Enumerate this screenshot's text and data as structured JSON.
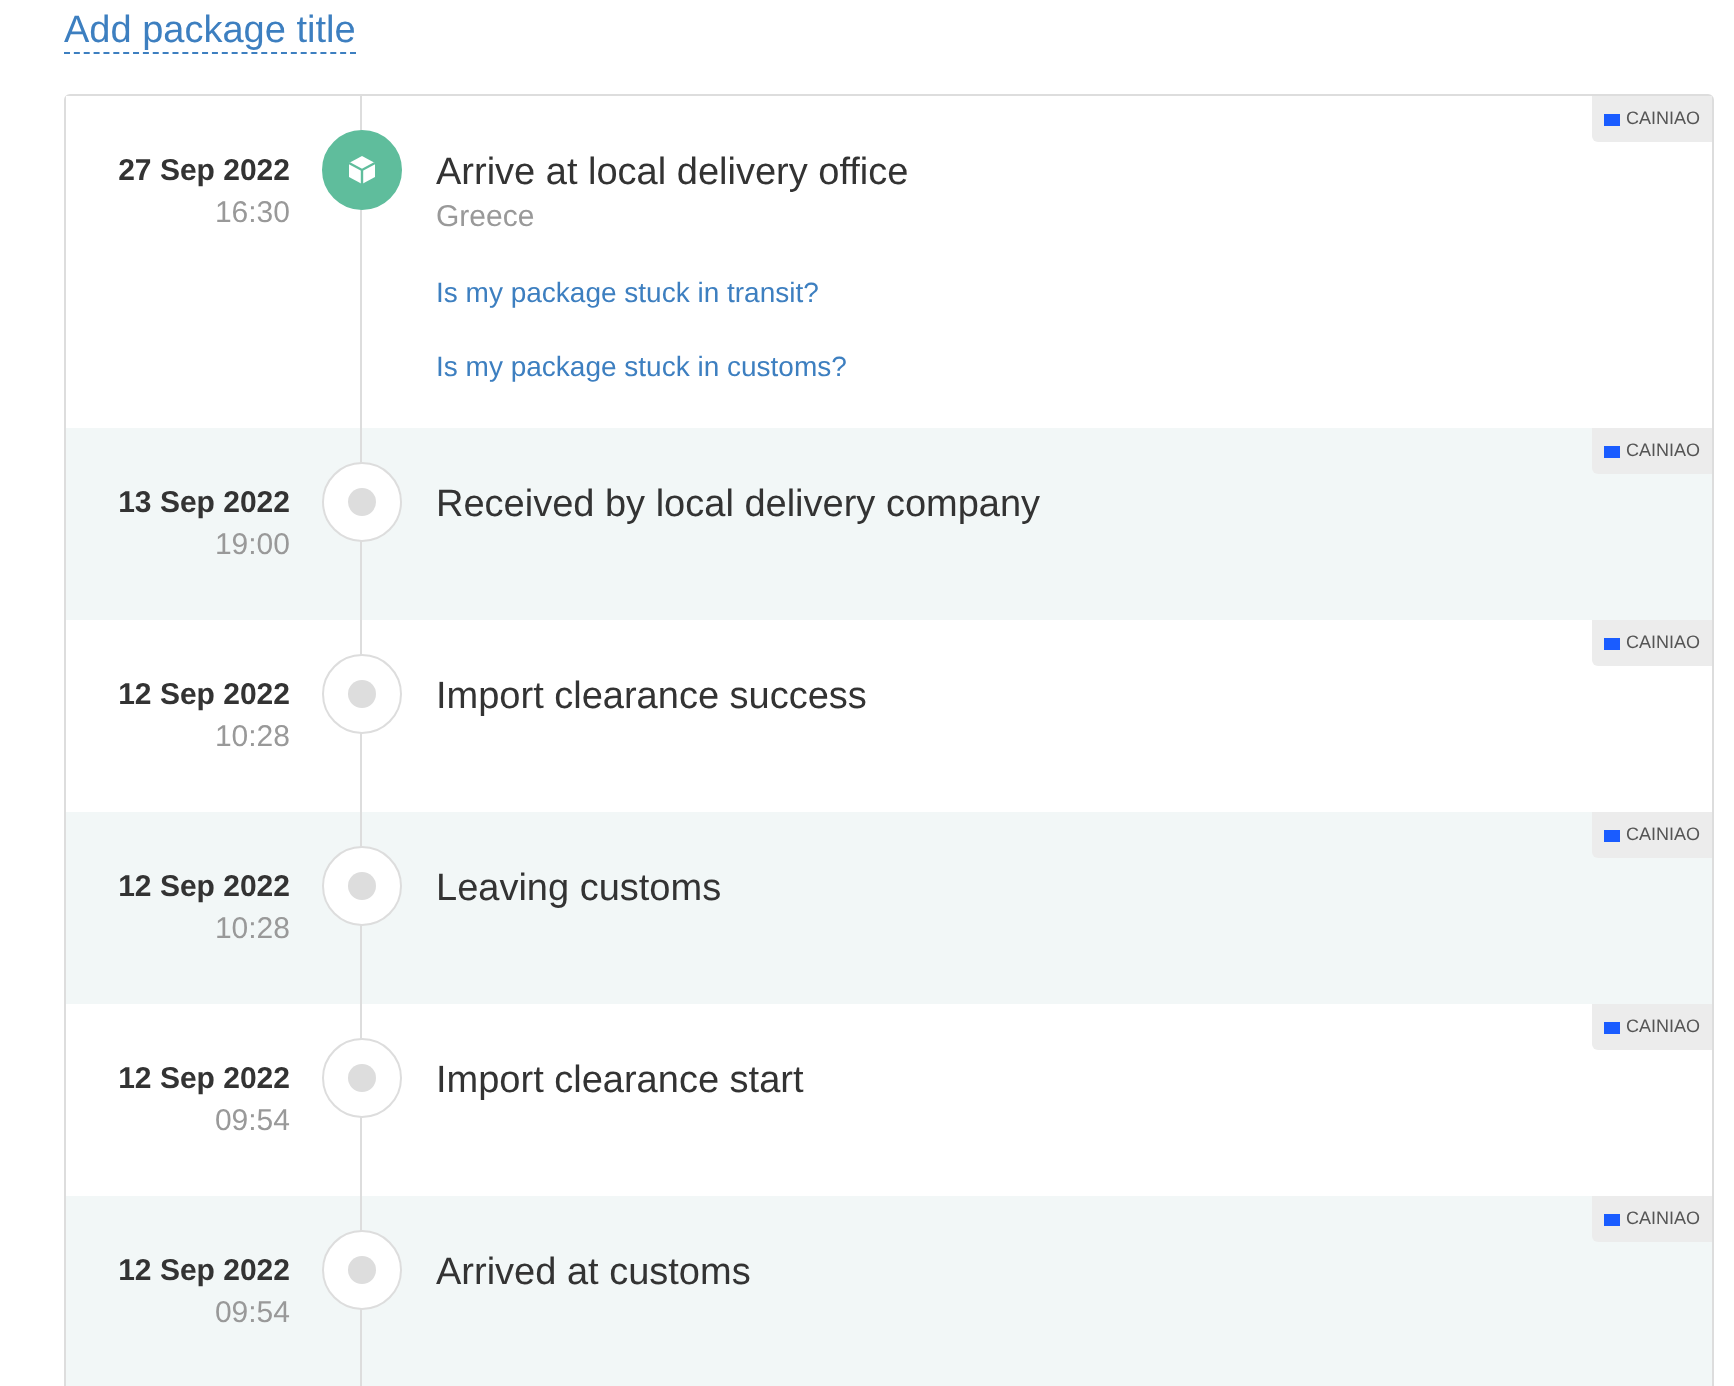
{
  "title_link": "Add package title",
  "events": [
    {
      "date": "27 Sep 2022",
      "time": "16:30",
      "status": "Arrive at local delivery office",
      "location": "Greece",
      "links": [
        "Is my package stuck in transit?",
        "Is my package stuck in customs?"
      ],
      "carrier": "CAINIAO",
      "active": true
    },
    {
      "date": "13 Sep 2022",
      "time": "19:00",
      "status": "Received by local delivery company",
      "carrier": "CAINIAO",
      "active": false
    },
    {
      "date": "12 Sep 2022",
      "time": "10:28",
      "status": "Import clearance success",
      "carrier": "CAINIAO",
      "active": false
    },
    {
      "date": "12 Sep 2022",
      "time": "10:28",
      "status": "Leaving customs",
      "carrier": "CAINIAO",
      "active": false
    },
    {
      "date": "12 Sep 2022",
      "time": "09:54",
      "status": "Import clearance start",
      "carrier": "CAINIAO",
      "active": false
    },
    {
      "date": "12 Sep 2022",
      "time": "09:54",
      "status": "Arrived at customs",
      "carrier": "CAINIAO",
      "active": false
    }
  ]
}
